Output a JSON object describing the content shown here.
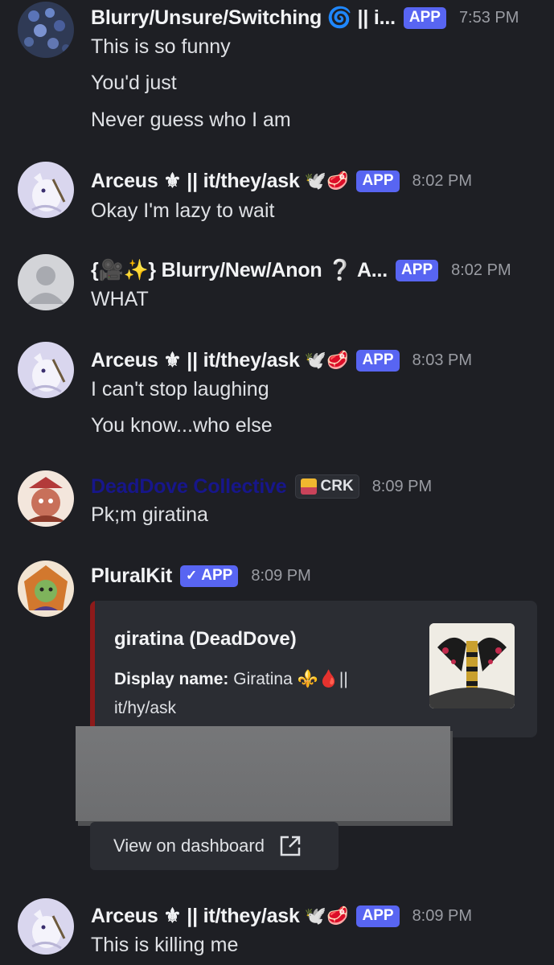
{
  "messages": [
    {
      "username": "Blurry/Unsure/Switching 🌀 || i...",
      "badge": "APP",
      "timestamp": "7:53 PM",
      "lines": [
        "This is so funny",
        "You'd just",
        "Never guess who I am"
      ]
    },
    {
      "username": "Arceus ⚜ || it/they/ask",
      "emoji": "🕊️🥩",
      "badge": "APP",
      "timestamp": "8:02 PM",
      "lines": [
        "Okay I'm lazy to wait"
      ]
    },
    {
      "username": "{🎥✨} Blurry/New/Anon ❔ A...",
      "badge": "APP",
      "timestamp": "8:02 PM",
      "lines": [
        "WHAT"
      ]
    },
    {
      "username": "Arceus ⚜ || it/they/ask",
      "emoji": "🕊️🥩",
      "badge": "APP",
      "timestamp": "8:03 PM",
      "lines": [
        "I can't stop laughing",
        "You know...who else"
      ]
    },
    {
      "username": "DeadDove Collective",
      "tag": "CRK",
      "timestamp": "8:09 PM",
      "lines": [
        "Pk;m giratina"
      ]
    },
    {
      "username": "PluralKit",
      "badge": "APP",
      "timestamp": "8:09 PM",
      "embed": {
        "title": "giratina (DeadDove)",
        "field_label": "Display name:",
        "field_value": "Giratina ⚜️🩸|| it/hy/ask"
      },
      "dashboard_button": "View on dashboard"
    },
    {
      "username": "Arceus ⚜ || it/they/ask",
      "emoji": "🕊️🥩",
      "badge": "APP",
      "timestamp": "8:09 PM",
      "lines": [
        "This is killing me"
      ]
    }
  ],
  "colors": {
    "background": "#1e1f24",
    "app_badge": "#5865f2",
    "embed_bar": "#8e1a1a",
    "deaddove_name": "#17168a"
  },
  "icons": [
    "default-avatar-icon",
    "checkmark-icon",
    "crown-icon",
    "external-link-icon"
  ]
}
